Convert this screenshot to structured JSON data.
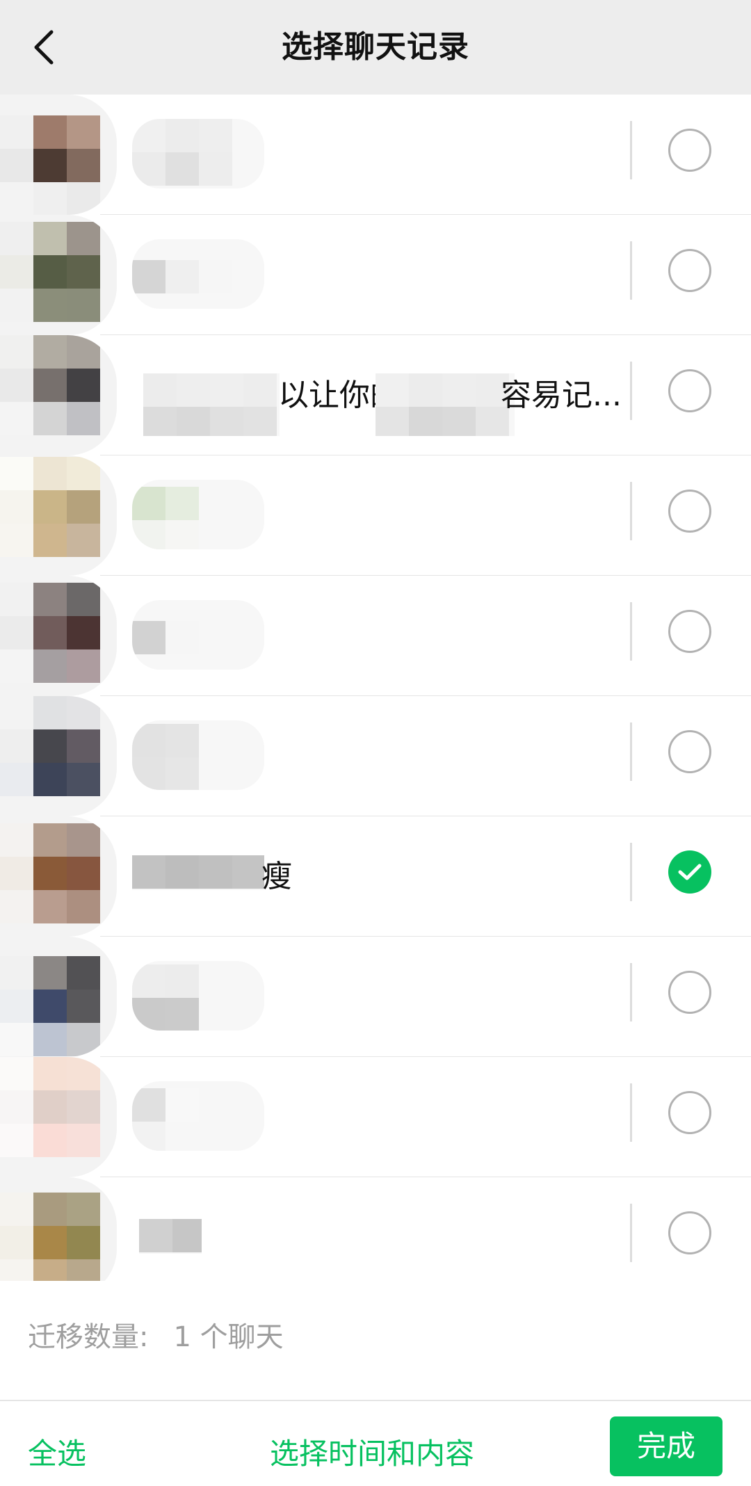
{
  "header": {
    "title": "选择聊天记录"
  },
  "chats": [
    {
      "visible_text": "",
      "selected": false
    },
    {
      "visible_text": "",
      "selected": false
    },
    {
      "visible_text": "以让你的",
      "visible_text_2": "容易记...",
      "selected": false
    },
    {
      "visible_text": "",
      "selected": false
    },
    {
      "visible_text": "",
      "selected": false
    },
    {
      "visible_text": "",
      "selected": false
    },
    {
      "visible_text": "瘦",
      "selected": true
    },
    {
      "visible_text": "",
      "selected": false
    },
    {
      "visible_text": "",
      "selected": false
    },
    {
      "visible_text": "",
      "selected": false
    }
  ],
  "footer": {
    "migrate_label": "迁移数量:",
    "migrate_value": "1 个聊天",
    "select_all": "全选",
    "select_time_content": "选择时间和内容",
    "done": "完成"
  },
  "colors": {
    "accent": "#07c160",
    "header_bg": "#ededed",
    "radio_border": "#b2b2b2",
    "muted_text": "#9e9e9e"
  },
  "icons": {
    "back": "chevron-left-icon",
    "check": "check-icon"
  }
}
